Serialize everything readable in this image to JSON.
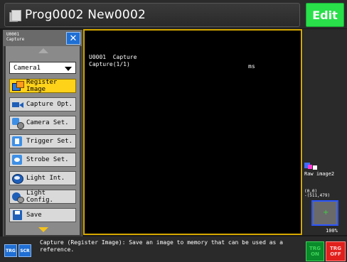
{
  "header": {
    "program_title": "Prog0002 New0002",
    "edit_label": "Edit"
  },
  "panel": {
    "unit_code": "U0001",
    "unit_name": "Capture",
    "camera_select": "Camera1",
    "items": [
      {
        "label": "Register Image",
        "icon": "register-image-icon",
        "active": true
      },
      {
        "label": "Capture Opt.",
        "icon": "camera-icon"
      },
      {
        "label": "Camera Set.",
        "icon": "camera-settings-icon"
      },
      {
        "label": "Trigger Set.",
        "icon": "trigger-icon"
      },
      {
        "label": "Strobe Set.",
        "icon": "strobe-icon"
      },
      {
        "label": "Light Int.",
        "icon": "light-icon"
      },
      {
        "label": "Light Config.",
        "icon": "light-config-icon"
      },
      {
        "label": "Save",
        "icon": "save-icon"
      }
    ]
  },
  "display": {
    "line1": "U0001  Capture",
    "line2": "Capture(1/1)",
    "unit": "ms"
  },
  "side": {
    "image_label": "Raw image2",
    "coord_line1": "(0,0)",
    "coord_line2": "-(511,479)",
    "zoom": "100%"
  },
  "footer": {
    "trg_label": "TRG",
    "scr_label": "SCR",
    "message": "Capture (Register Image): Save an image to memory that can be used as a reference.",
    "trg_on_1": "TRG",
    "trg_on_2": "ON",
    "trg_off_1": "TRG",
    "trg_off_2": "OFF"
  },
  "colors": {
    "edit_green": "#29e04a",
    "active_yellow": "#ffd21a",
    "display_border": "#d6a800",
    "trg_off_red": "#e0201c"
  }
}
